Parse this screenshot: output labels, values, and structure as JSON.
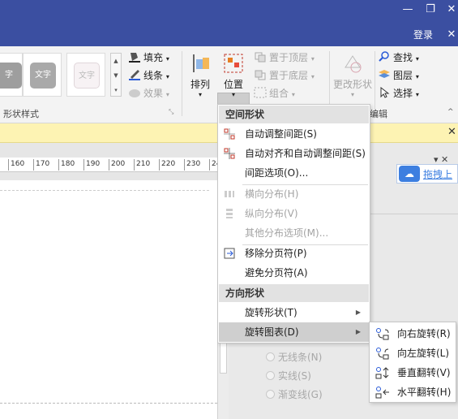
{
  "window": {
    "minimize": "—",
    "restore": "❐",
    "close": "✕",
    "login": "登录",
    "ribbon_close": "✕"
  },
  "ribbon": {
    "style_thumbs": [
      "字",
      "文字",
      "文字"
    ],
    "fill": "填充",
    "line": "线条",
    "effect": "效果",
    "shape_styles_label": "形状样式",
    "arrange": "排列",
    "position": "位置",
    "bring_front": "置于顶层",
    "send_back": "置于底层",
    "group": "组合",
    "change_shape": "更改形状",
    "find": "查找",
    "layers": "图层",
    "select": "选择",
    "edit_label": "编辑"
  },
  "msgbar": {
    "close": "✕"
  },
  "ruler": {
    "ticks": [
      "160",
      "170",
      "180",
      "190",
      "200",
      "210",
      "220",
      "230",
      "24"
    ]
  },
  "rightpane": {
    "drag_button": "拖拽上",
    "line_options": [
      "无线条(N)",
      "实线(S)",
      "渐变线(G)"
    ]
  },
  "menu": {
    "header_space": "空间形状",
    "auto_space": "自动调整间距(S)",
    "auto_align_space": "自动对齐和自动调整间距(S)",
    "space_options": "间距选项(O)...",
    "distribute_h": "横向分布(H)",
    "distribute_v": "纵向分布(V)",
    "more_distribute": "其他分布选项(M)...",
    "remove_page_breaks": "移除分页符(P)",
    "avoid_page_breaks": "避免分页符(A)",
    "header_orient": "方向形状",
    "rotate_shapes": "旋转形状(T)",
    "rotate_diagram": "旋转图表(D)"
  },
  "submenu": {
    "rotate_right": "向右旋转(R)",
    "rotate_left": "向左旋转(L)",
    "flip_vertical": "垂直翻转(V)",
    "flip_horizontal": "水平翻转(H)"
  },
  "colors": {
    "titlebar": "#3b4fa1",
    "msgbar": "#fdf3b3",
    "accent_blue": "#3d7fe0",
    "menu_highlight": "#cfcfcf"
  }
}
